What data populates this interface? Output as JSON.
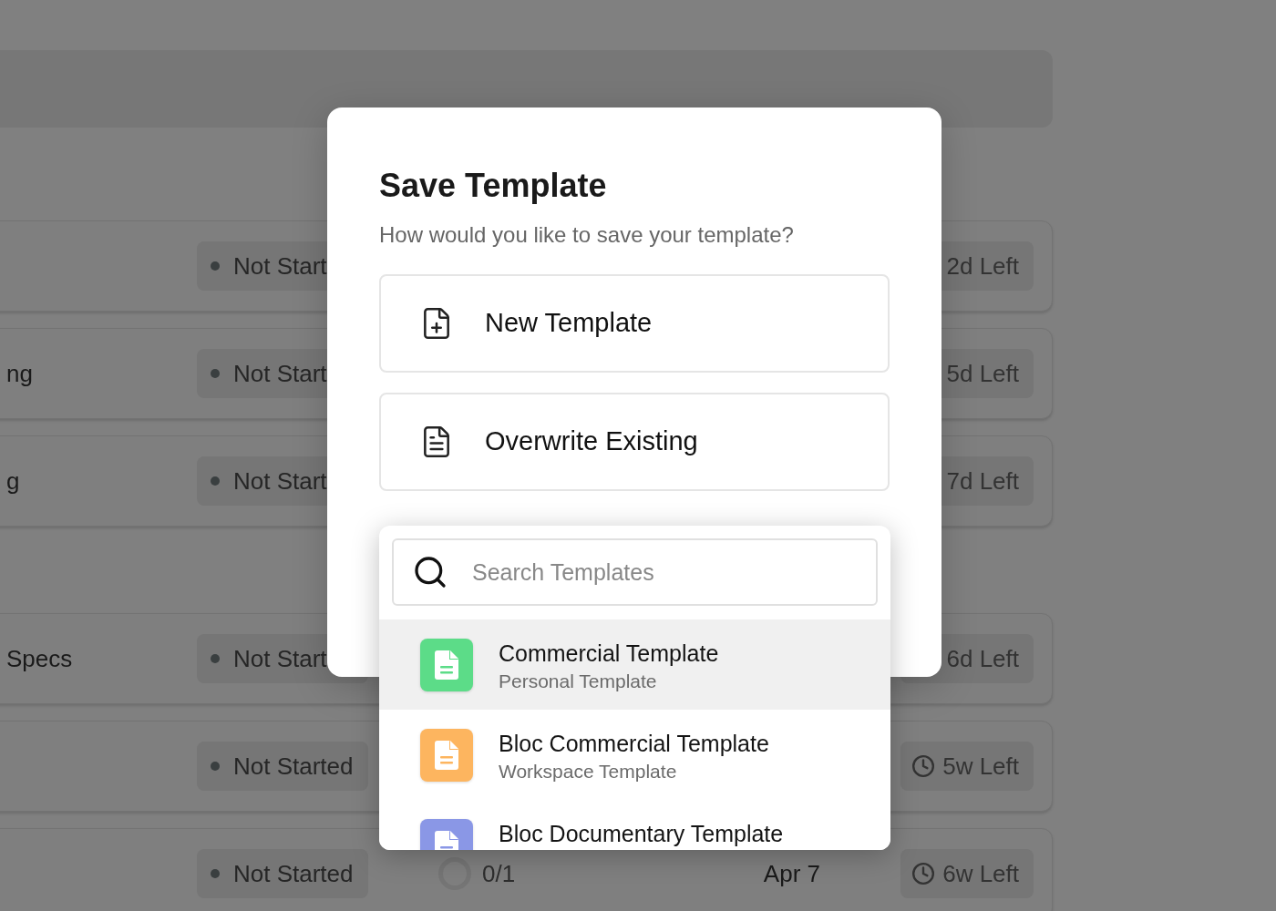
{
  "background": {
    "rows": [
      {
        "kind": "covered",
        "name": "",
        "status": "Not Start",
        "time_left": "2d Left"
      },
      {
        "kind": "covered",
        "name": "ng",
        "status": "Not Start",
        "time_left": "5d Left"
      },
      {
        "kind": "covered",
        "name": "g",
        "status": "Not Start",
        "time_left": "7d Left"
      },
      {
        "kind": "covered",
        "name": "Specs",
        "status": "Not Start",
        "time_left": "6d Left"
      },
      {
        "kind": "partial",
        "name": "",
        "status": "Not Started",
        "time_left": "5w Left"
      },
      {
        "kind": "open",
        "name": "",
        "status": "Not Started",
        "progress": "0/1",
        "date": "Apr 7",
        "time_left": "6w Left"
      }
    ]
  },
  "dialog": {
    "title": "Save Template",
    "subtitle": "How would you like to save your template?",
    "options": [
      {
        "kind": "new",
        "label": "New Template"
      },
      {
        "kind": "existing",
        "label": "Overwrite Existing"
      }
    ]
  },
  "dropdown": {
    "search": {
      "placeholder": "Search Templates"
    },
    "items": [
      {
        "title": "Commercial Template",
        "subtitle": "Personal Template",
        "color": "#5cdc88",
        "selected": true
      },
      {
        "title": "Bloc Commercial Template",
        "subtitle": "Workspace Template",
        "color": "#fdb55f",
        "selected": false
      },
      {
        "title": "Bloc Documentary Template",
        "color": "#8a97e6",
        "selected": false
      }
    ]
  }
}
